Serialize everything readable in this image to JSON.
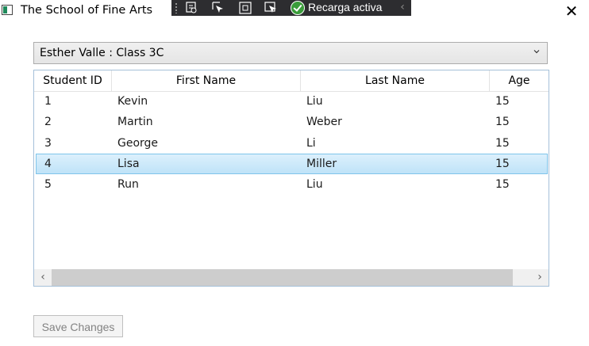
{
  "window": {
    "title": "The School of Fine Arts",
    "icon": "app-window-icon",
    "close_icon": "close-icon"
  },
  "debug_toolbar": {
    "tools": [
      {
        "name": "live-visual-tree-icon"
      },
      {
        "name": "select-element-icon"
      },
      {
        "name": "display-layout-adorners-icon"
      },
      {
        "name": "track-focus-icon"
      }
    ],
    "hot_reload_label": "Recarga activa",
    "collapse_glyph": "‹",
    "status_color": "#3a9c3a"
  },
  "class_selector": {
    "selected": "Esther Valle : Class 3C"
  },
  "grid": {
    "columns": [
      "Student ID",
      "First Name",
      "Last Name",
      "Age"
    ],
    "rows": [
      {
        "id": "1",
        "first": "Kevin",
        "last": "Liu",
        "age": "15"
      },
      {
        "id": "2",
        "first": "Martin",
        "last": "Weber",
        "age": "15"
      },
      {
        "id": "3",
        "first": "George",
        "last": "Li",
        "age": "15"
      },
      {
        "id": "4",
        "first": "Lisa",
        "last": "Miller",
        "age": "15"
      },
      {
        "id": "5",
        "first": "Run",
        "last": "Liu",
        "age": "15"
      }
    ],
    "selected_row_index": 3,
    "selection_color": "#cce8ff"
  },
  "scrollbar": {
    "left_glyph": "‹",
    "right_glyph": "›"
  },
  "actions": {
    "save_label": "Save Changes"
  }
}
